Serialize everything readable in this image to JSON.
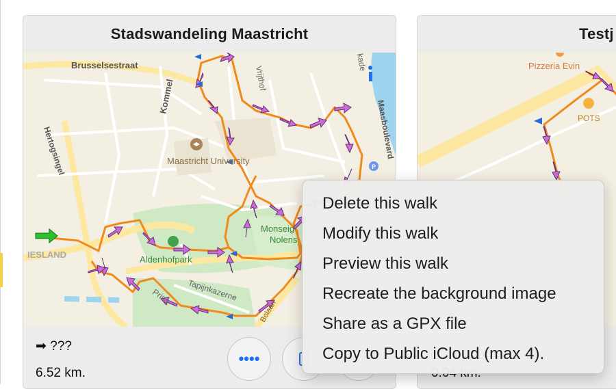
{
  "cards": {
    "main": {
      "title": "Stadswandeling Maastricht",
      "direction": "➡ ???",
      "distance": "6.52 km.",
      "more_button": "••••",
      "map_labels": {
        "brusselsestraat": "Brusselsestraat",
        "kommel": "Kommel",
        "vrijthof": "Vrijthof",
        "kade": "kade",
        "maasboulevard": "Maasboulevard",
        "hertogsingel": "Hertogsingel",
        "university": "Maastricht University",
        "monseig": "Monseig",
        "nolens": "Nolens",
        "aldenhofpark": "Aldenhofpark",
        "tapijnkazerne": "Tapijnkazerne",
        "prins": "Prins",
        "bolaan": "Bolaan",
        "iesland": "IESLAND"
      }
    },
    "next": {
      "title": "Testj",
      "distance": "0.04 km.",
      "map_labels": {
        "pizzeria": "Pizzeria Evin",
        "pots": "POTS"
      }
    }
  },
  "context_menu": {
    "items": [
      "Delete this walk",
      "Modify this walk",
      "Preview this walk",
      "Recreate the background image",
      "Share as a GPX file",
      "Copy to Public iCloud (max 4)."
    ]
  },
  "colors": {
    "route": "#f08a1c",
    "arrow": "#c86fd6",
    "water": "#9fd4ee",
    "park": "#cfe9c5",
    "map_bg": "#f4efe3"
  }
}
